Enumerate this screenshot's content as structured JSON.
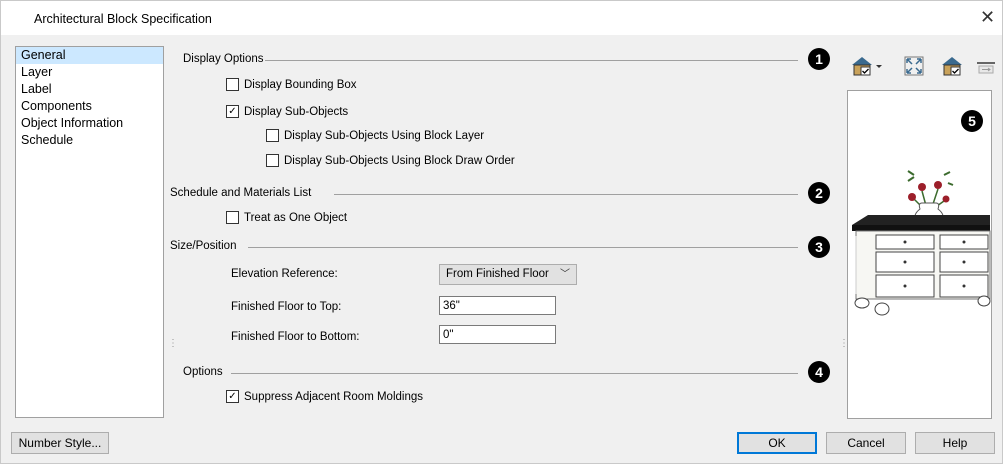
{
  "window": {
    "title": "Architectural Block Specification",
    "close_glyph": "✕"
  },
  "nav": {
    "items": [
      "General",
      "Layer",
      "Label",
      "Components",
      "Object Information",
      "Schedule"
    ],
    "selected": 0
  },
  "display_options": {
    "title": "Display Options",
    "badge": "1",
    "bounding_box": {
      "label": "Display Bounding Box",
      "checked": false
    },
    "sub_objects": {
      "label": "Display Sub-Objects",
      "checked": true
    },
    "block_layer": {
      "label": "Display Sub-Objects Using Block Layer",
      "checked": false
    },
    "draw_order": {
      "label": "Display Sub-Objects Using Block Draw Order",
      "checked": false
    }
  },
  "schedule": {
    "title": "Schedule and Materials List",
    "badge": "2",
    "one_object": {
      "label": "Treat as One Object",
      "checked": false
    }
  },
  "size_position": {
    "title": "Size/Position",
    "badge": "3",
    "elevation_label": "Elevation Reference:",
    "elevation_value": "From Finished Floor",
    "top_label": "Finished Floor to Top:",
    "top_value": "36\"",
    "bottom_label": "Finished Floor to Bottom:",
    "bottom_value": "0\""
  },
  "options": {
    "title": "Options",
    "badge": "4",
    "suppress": {
      "label": "Suppress Adjacent Room Moldings",
      "checked": true
    }
  },
  "preview": {
    "badge": "5"
  },
  "buttons": {
    "number_style": "Number Style...",
    "ok": "OK",
    "cancel": "Cancel",
    "help": "Help"
  },
  "icons": [
    "view-mode-icon",
    "fit-view-icon",
    "render-icon",
    "toggle-icon"
  ],
  "colors": {
    "selection": "#cce8ff",
    "default_button_border": "#0078d7"
  }
}
